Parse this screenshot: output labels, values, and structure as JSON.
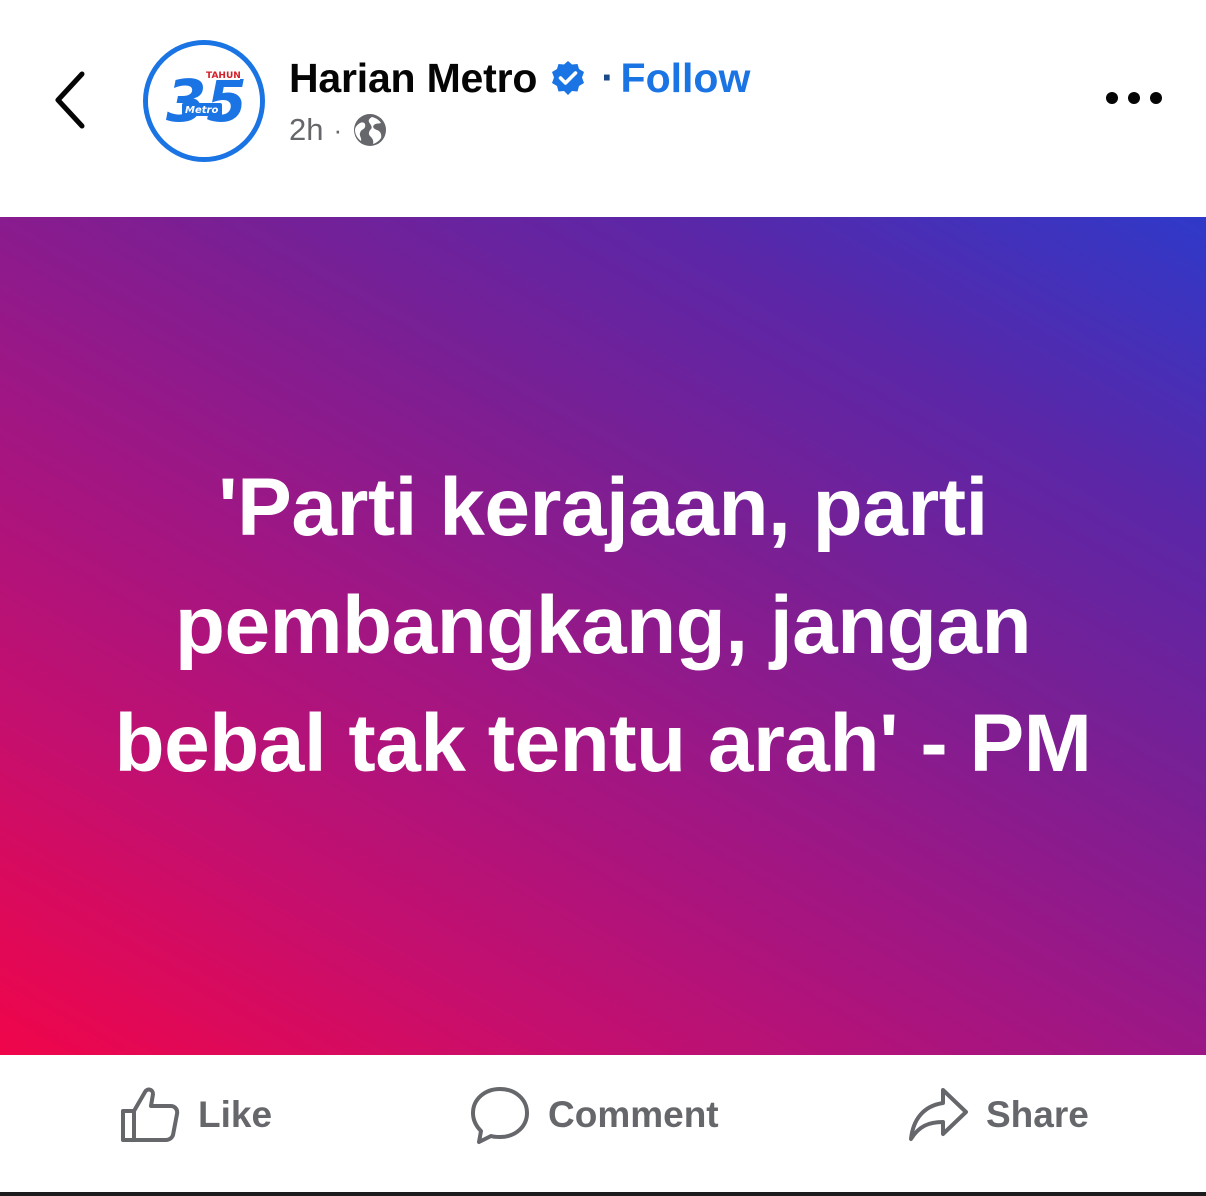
{
  "header": {
    "page_name": "Harian Metro",
    "separator": "·",
    "follow_label": "Follow",
    "time": "2h",
    "meta_dot": "·",
    "avatar_text": {
      "number": "35",
      "tag": "TAHUN",
      "brand": "Metro"
    }
  },
  "post": {
    "text": "'Parti kerajaan, parti pembangkang, jangan bebal tak tentu arah' - PM"
  },
  "actions": {
    "like_label": "Like",
    "comment_label": "Comment",
    "share_label": "Share"
  },
  "icons": {
    "back": "chevron-left-icon",
    "verified": "verified-badge-icon",
    "privacy": "globe-icon",
    "more": "more-horizontal-icon",
    "like": "thumbs-up-icon",
    "comment": "comment-bubble-icon",
    "share": "share-arrow-icon"
  },
  "colors": {
    "brand_blue": "#1b74e4",
    "text_primary": "#050505",
    "text_secondary": "#65676b",
    "gradient_start": "#f0054a",
    "gradient_end": "#2f39c9"
  }
}
